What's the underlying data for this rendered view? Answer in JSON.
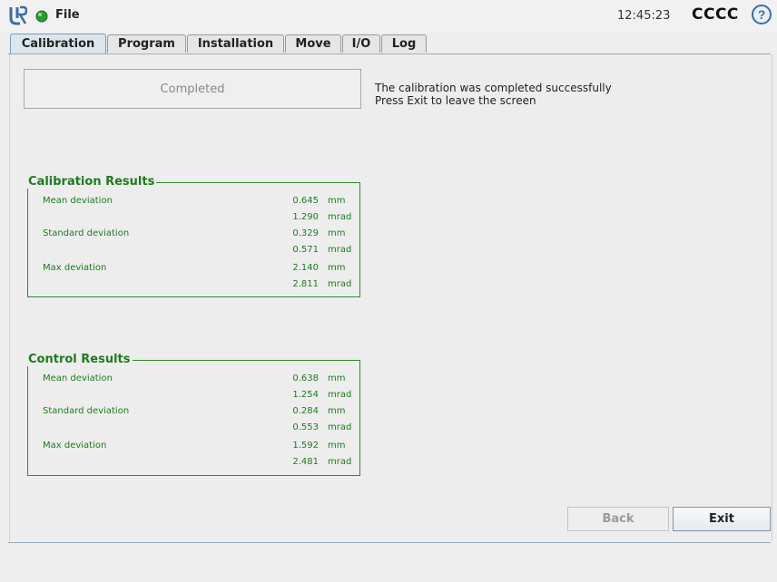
{
  "topbar": {
    "menu_label": "File",
    "time": "12:45:23",
    "robot_name": "CCCC",
    "help_symbol": "?",
    "logo_icon": "ur-logo-icon",
    "status_icon": "robot-status-icon",
    "status_color": "#2e9a2e",
    "accent_color": "#3a6ea5"
  },
  "tabs": [
    {
      "label": "Calibration",
      "active": true
    },
    {
      "label": "Program"
    },
    {
      "label": "Installation"
    },
    {
      "label": "Move"
    },
    {
      "label": "I/O"
    },
    {
      "label": "Log"
    }
  ],
  "status": {
    "box_label": "Completed",
    "message_line1": "The calibration was completed successfully",
    "message_line2": "Press Exit to leave the screen"
  },
  "calibration_results": {
    "title": "Calibration Results",
    "rows": [
      {
        "label": "Mean deviation",
        "value": "0.645",
        "unit": "mm"
      },
      {
        "label": "",
        "value": "1.290",
        "unit": "mrad"
      },
      {
        "label": "Standard deviation",
        "value": "0.329",
        "unit": "mm"
      },
      {
        "label": "",
        "value": "0.571",
        "unit": "mrad"
      },
      {
        "label": "Max deviation",
        "value": "2.140",
        "unit": "mm"
      },
      {
        "label": "",
        "value": "2.811",
        "unit": "mrad"
      }
    ]
  },
  "control_results": {
    "title": "Control Results",
    "rows": [
      {
        "label": "Mean deviation",
        "value": "0.638",
        "unit": "mm"
      },
      {
        "label": "",
        "value": "1.254",
        "unit": "mrad"
      },
      {
        "label": "Standard deviation",
        "value": "0.284",
        "unit": "mm"
      },
      {
        "label": "",
        "value": "0.553",
        "unit": "mrad"
      },
      {
        "label": "Max deviation",
        "value": "1.592",
        "unit": "mm"
      },
      {
        "label": "",
        "value": "2.481",
        "unit": "mrad"
      }
    ]
  },
  "buttons": {
    "back": "Back",
    "exit": "Exit"
  },
  "group_color": "#1f7a1f"
}
